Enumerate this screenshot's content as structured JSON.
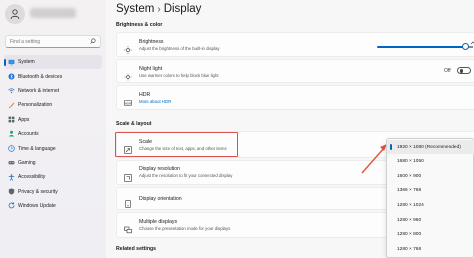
{
  "sidebar": {
    "search_placeholder": "Find a setting",
    "items": [
      {
        "label": "System",
        "icon": "monitor-icon"
      },
      {
        "label": "Bluetooth & devices",
        "icon": "bluetooth-icon"
      },
      {
        "label": "Network & internet",
        "icon": "wifi-icon"
      },
      {
        "label": "Personalization",
        "icon": "brush-icon"
      },
      {
        "label": "Apps",
        "icon": "apps-icon"
      },
      {
        "label": "Accounts",
        "icon": "person-icon"
      },
      {
        "label": "Time & language",
        "icon": "globe-clock-icon"
      },
      {
        "label": "Gaming",
        "icon": "gamepad-icon"
      },
      {
        "label": "Accessibility",
        "icon": "accessibility-icon"
      },
      {
        "label": "Privacy & security",
        "icon": "shield-icon"
      },
      {
        "label": "Windows Update",
        "icon": "update-icon"
      }
    ]
  },
  "header": {
    "crumb_parent": "System",
    "crumb_sep": "›",
    "crumb_current": "Display"
  },
  "sections": {
    "brightness_color": "Brightness & color",
    "scale_layout": "Scale & layout",
    "related": "Related settings"
  },
  "cards": {
    "brightness": {
      "title": "Brightness",
      "subtitle": "Adjust the brightness of the built-in display",
      "level": 0.92
    },
    "night_light": {
      "title": "Night light",
      "subtitle": "Use warmer colors to help block blue light",
      "toggle_label": "Off"
    },
    "hdr": {
      "title": "HDR",
      "subtitle": "More about HDR"
    },
    "scale": {
      "title": "Scale",
      "subtitle": "Change the size of text, apps, and other items"
    },
    "resolution": {
      "title": "Display resolution",
      "subtitle": "Adjust the resolution to fit your connected display"
    },
    "orientation": {
      "title": "Display orientation"
    },
    "multiple": {
      "title": "Multiple displays",
      "subtitle": "Choose the presentation mode for your displays"
    }
  },
  "resolution_options": [
    "1920 × 1080 (Recommended)",
    "1680 × 1050",
    "1600 × 900",
    "1366 × 768",
    "1280 × 1024",
    "1280 × 960",
    "1280 × 800",
    "1280 × 768"
  ],
  "selected_resolution_index": 0,
  "colors": {
    "accent": "#0067c0",
    "highlight_box": "#d9534f",
    "arrow": "#e0533a"
  }
}
